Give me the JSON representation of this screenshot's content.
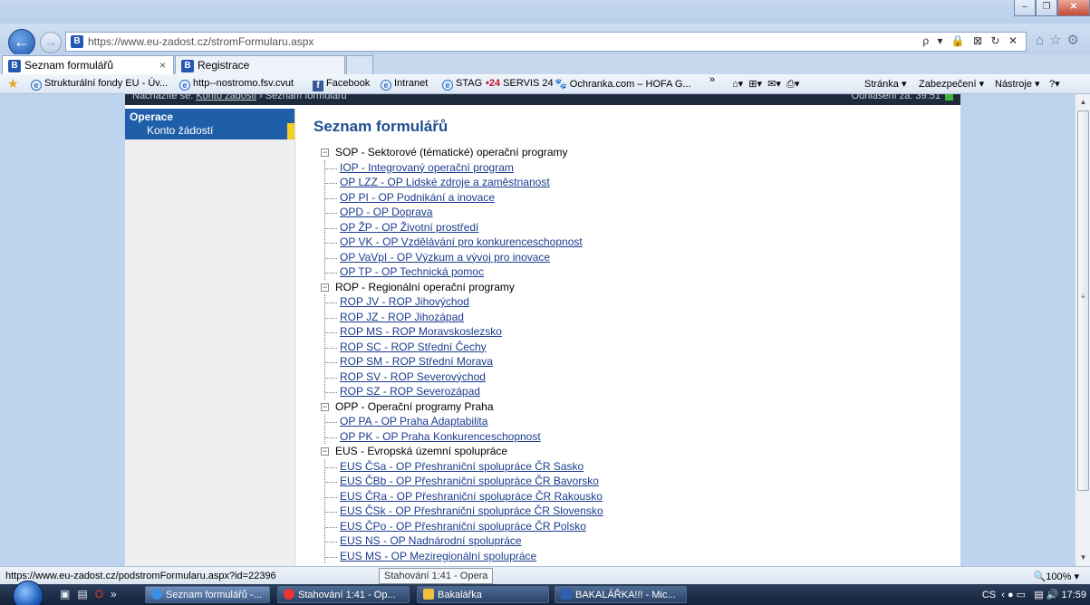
{
  "browser": {
    "address_url": "https://www.eu-zadost.cz/stromFormularu.aspx",
    "address_icons": "ρ ▾ 🔒 ⊠ ↻ ✕",
    "tabs": [
      {
        "label": "Seznam formulářů",
        "close": "×"
      },
      {
        "label": "Registrace"
      }
    ],
    "favorites": [
      {
        "label": "Strukturální fondy EU - Úv...",
        "icon": "ie"
      },
      {
        "label": "http--nostromo.fsv.cvut",
        "icon": "ie"
      },
      {
        "label": "Facebook",
        "icon": "facebook"
      },
      {
        "label": "Intranet",
        "icon": "ie"
      },
      {
        "label": "STAG",
        "icon": "ie"
      },
      {
        "label": "SERVIS 24",
        "prefix": "•24"
      },
      {
        "label": "Ochranka.com – HOFA G...",
        "icon": "paw"
      }
    ],
    "command_bar": {
      "page": "Stránka ▾",
      "safety": "Zabezpečení ▾",
      "tools": "Nástroje ▾"
    }
  },
  "page": {
    "topband_left": "Nacházíte se:",
    "topband_link": "Konto žádosti",
    "topband_current": "Seznam formulářů",
    "topband_right": "Odhlášení za: 39:51",
    "sidebar": {
      "heading": "Operace",
      "items": [
        "Konto žádostí"
      ]
    },
    "title": "Seznam formulářů",
    "groups": [
      {
        "label": "SOP - Sektorové (tématické) operační programy",
        "items": [
          "IOP - Integrovaný operační program",
          "OP LZZ - OP Lidské zdroje a zaměstnanost",
          "OP PI - OP Podnikání a inovace",
          "OPD - OP Doprava",
          "OP ŽP - OP Životní prostředí",
          "OP VK - OP Vzdělávání pro konkurenceschopnost",
          "OP VaVpI - OP Výzkum a vývoj pro inovace",
          "OP TP - OP Technická pomoc"
        ]
      },
      {
        "label": "ROP - Regionální operační programy",
        "items": [
          "ROP JV - ROP Jihovýchod",
          "ROP JZ - ROP Jihozápad",
          "ROP MS - ROP Moravskoslezsko",
          "ROP SC - ROP Střední Čechy",
          "ROP SM - ROP Střední Morava",
          "ROP SV - ROP Severovýchod",
          "ROP SZ - ROP Severozápad"
        ]
      },
      {
        "label": "OPP - Operační programy Praha",
        "items": [
          "OP PA - OP Praha Adaptabilita",
          "OP PK - OP Praha Konkurenceschopnost"
        ]
      },
      {
        "label": "EUS - Evropská územní spolupráce",
        "items": [
          "EUS ČSa - OP Přeshraniční spolupráce ČR Sasko",
          "EUS ČBb - OP Přeshraniční spolupráce ČR Bavorsko",
          "EUS ČRa - OP Přeshraniční spolupráce ČR Rakousko",
          "EUS ČSk - OP Přeshraniční spolupráce ČR Slovensko",
          "EUS ČPo - OP Přeshraniční spolupráce ČR Polsko",
          "EUS NS - OP Nadnárodní spolupráce",
          "EUS MS - OP Meziregionální spolupráce"
        ]
      }
    ]
  },
  "status": {
    "url": "https://www.eu-zadost.cz/podstromFormularu.aspx?id=22396",
    "tooltip": "Stahování 1:41 - Opera",
    "zoom": "100%"
  },
  "taskbar": {
    "tasks": [
      {
        "label": "Seznam formulářů -..."
      },
      {
        "label": "Stahování 1:41 - Op..."
      },
      {
        "label": "Bakalářka"
      },
      {
        "label": "BAKALÁŘKA!!! - Mic..."
      }
    ],
    "lang": "CS",
    "time": "17:59"
  },
  "colors": {
    "accent": "#1f5ea8",
    "sidebar_marker": "#f2d220",
    "link": "#1a3c8e",
    "title": "#1f4f8f"
  }
}
